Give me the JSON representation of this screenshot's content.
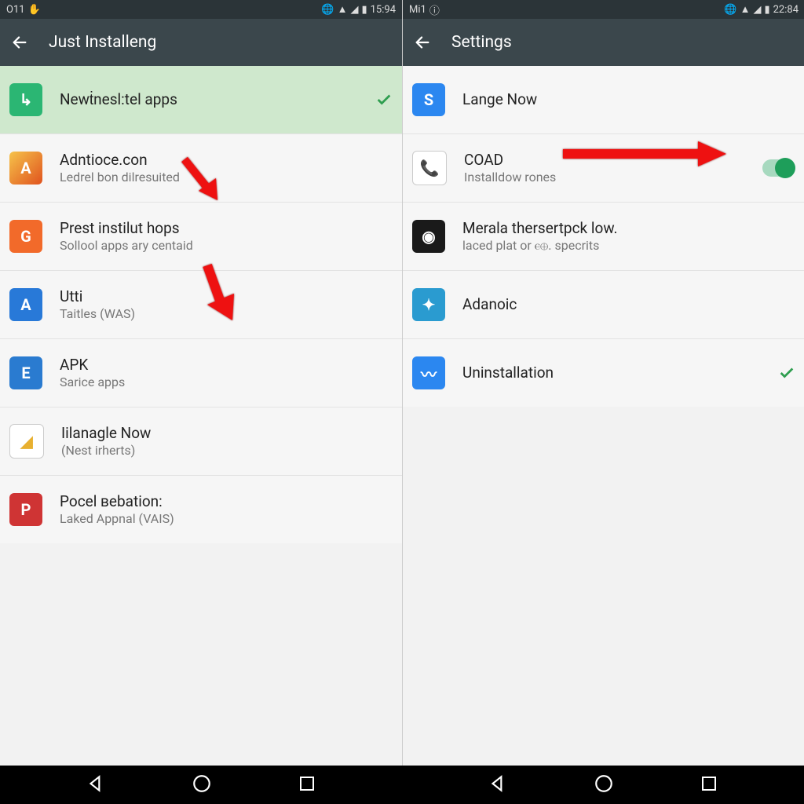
{
  "left": {
    "status": {
      "left": "O11",
      "time": "15:94"
    },
    "title": "Just Installeng",
    "rows": [
      {
        "icon": "bg-green",
        "glyph": "↳",
        "t1": "Newṫnesl:tel apps",
        "t2": "",
        "check": true
      },
      {
        "icon": "bg-gold",
        "glyph": "A",
        "t1": "Adntioce.con",
        "t2": "Ledrel bon dilresuited"
      },
      {
        "icon": "bg-orange",
        "glyph": "G",
        "t1": "Prest instilut hops",
        "t2": "Sollool apps ary centaid"
      },
      {
        "icon": "bg-blue",
        "glyph": "A",
        "t1": "Utti",
        "t2": "Taitles (WAS)"
      },
      {
        "icon": "bg-bluec",
        "glyph": "E",
        "t1": "APK",
        "t2": "Sarice apps"
      },
      {
        "icon": "bg-tri",
        "glyph": "◢",
        "t1": "Iilanagle Now",
        "t2": "(Nest irherts)"
      },
      {
        "icon": "bg-red",
        "glyph": "P",
        "t1": "Pocel вebation:",
        "t2": "Laked Appnal (VAIS)"
      }
    ]
  },
  "right": {
    "status": {
      "left": "Mi1",
      "time": "22:84"
    },
    "title": "Settings",
    "rows": [
      {
        "icon": "bg-sfile",
        "glyph": "S",
        "t1": "Lange Now",
        "t2": ""
      },
      {
        "icon": "bg-white",
        "glyph": "📞",
        "t1": "COAD",
        "t2": "Installdow rones",
        "toggle": true
      },
      {
        "icon": "bg-dark",
        "glyph": "◉",
        "t1": "Merala thersertpck low.",
        "t2": "laced plat or ⲉ⊕. specrits"
      },
      {
        "icon": "bg-teal",
        "glyph": "✦",
        "t1": "Adanoic",
        "t2": ""
      },
      {
        "icon": "bg-msg",
        "glyph": "〰",
        "t1": "Uninstallation",
        "t2": "",
        "check": true
      }
    ]
  }
}
